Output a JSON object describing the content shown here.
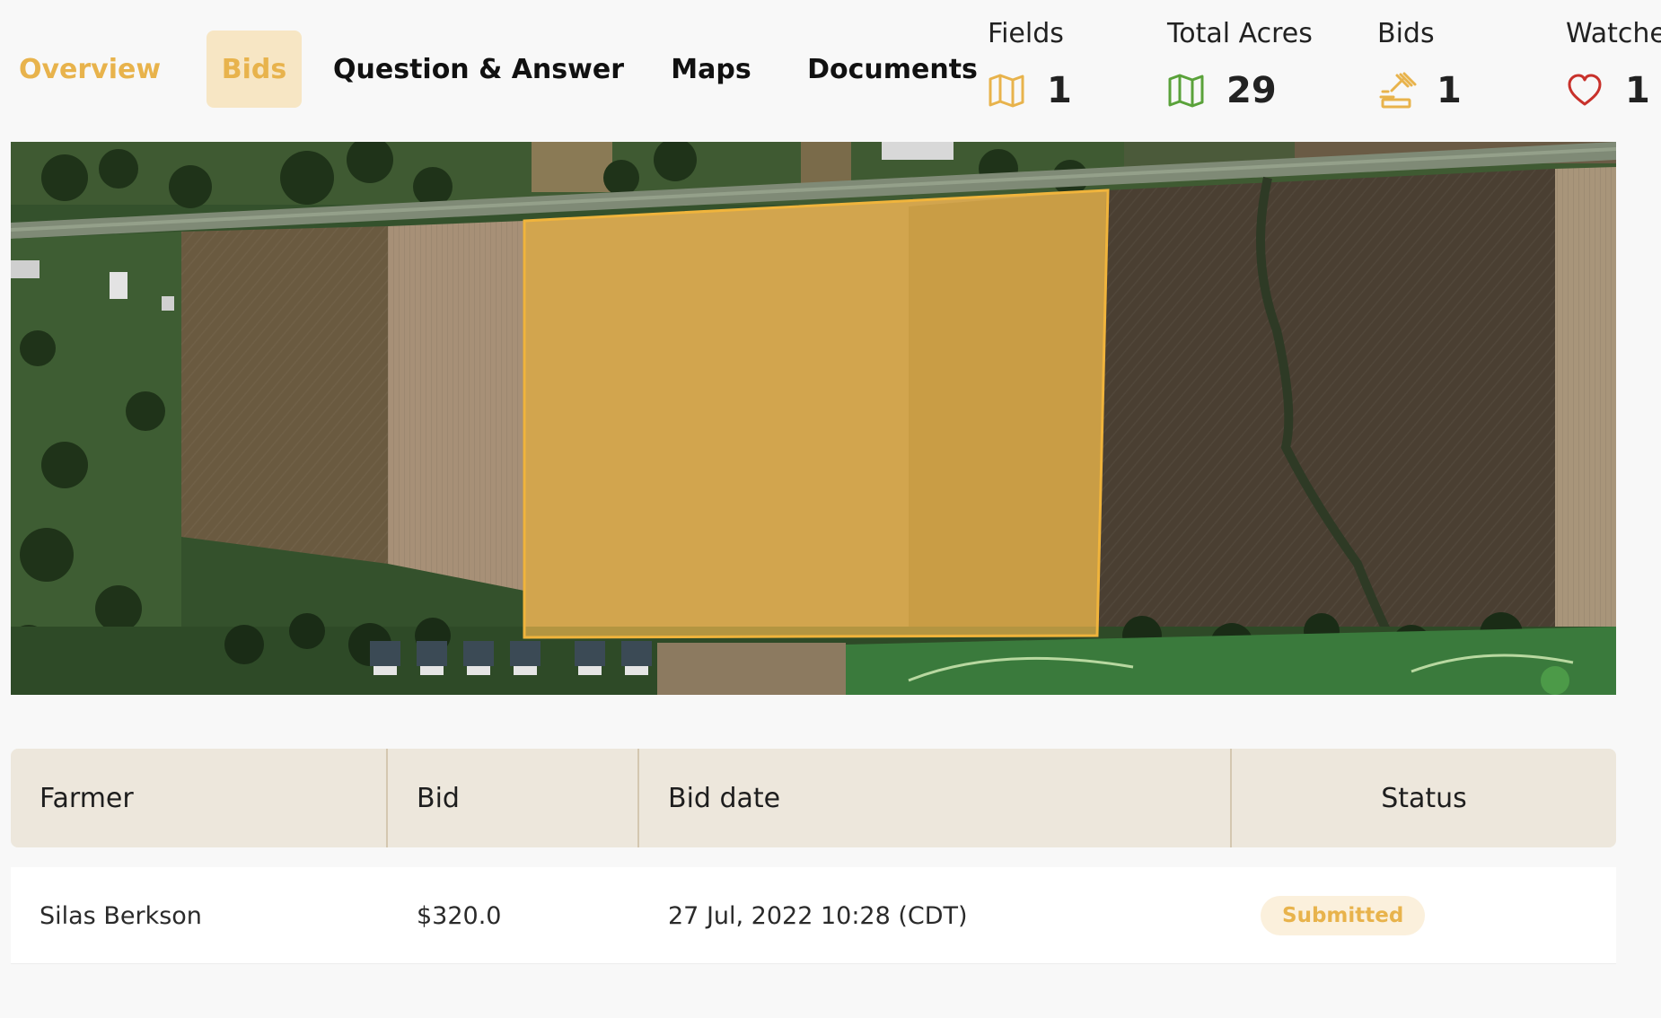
{
  "tabs": [
    {
      "label": "Overview"
    },
    {
      "label": "Bids"
    },
    {
      "label": "Question & Answer"
    },
    {
      "label": "Maps"
    },
    {
      "label": "Documents"
    }
  ],
  "stats": {
    "fields": {
      "label": "Fields",
      "value": "1",
      "icon": "map-icon",
      "color": "#e8b34c"
    },
    "total_acres": {
      "label": "Total Acres",
      "value": "29",
      "icon": "map-icon",
      "color": "#5aa23a"
    },
    "bids": {
      "label": "Bids",
      "value": "1",
      "icon": "gavel-icon",
      "color": "#e8b34c"
    },
    "watchers": {
      "label": "Watchers",
      "value": "1",
      "icon": "heart-icon",
      "color": "#c8312b"
    }
  },
  "colors": {
    "accent": "#e8b34c",
    "accent_bg": "#f7e6c4",
    "table_header_bg": "#ede7dc",
    "field_highlight": "#e8b34c"
  },
  "bids_table": {
    "headers": {
      "farmer": "Farmer",
      "bid": "Bid",
      "bid_date": "Bid date",
      "status": "Status"
    },
    "rows": [
      {
        "farmer": "Silas Berkson",
        "bid": "$320.0",
        "bid_date": "27 Jul, 2022 10:28 (CDT)",
        "status": "Submitted"
      }
    ]
  }
}
